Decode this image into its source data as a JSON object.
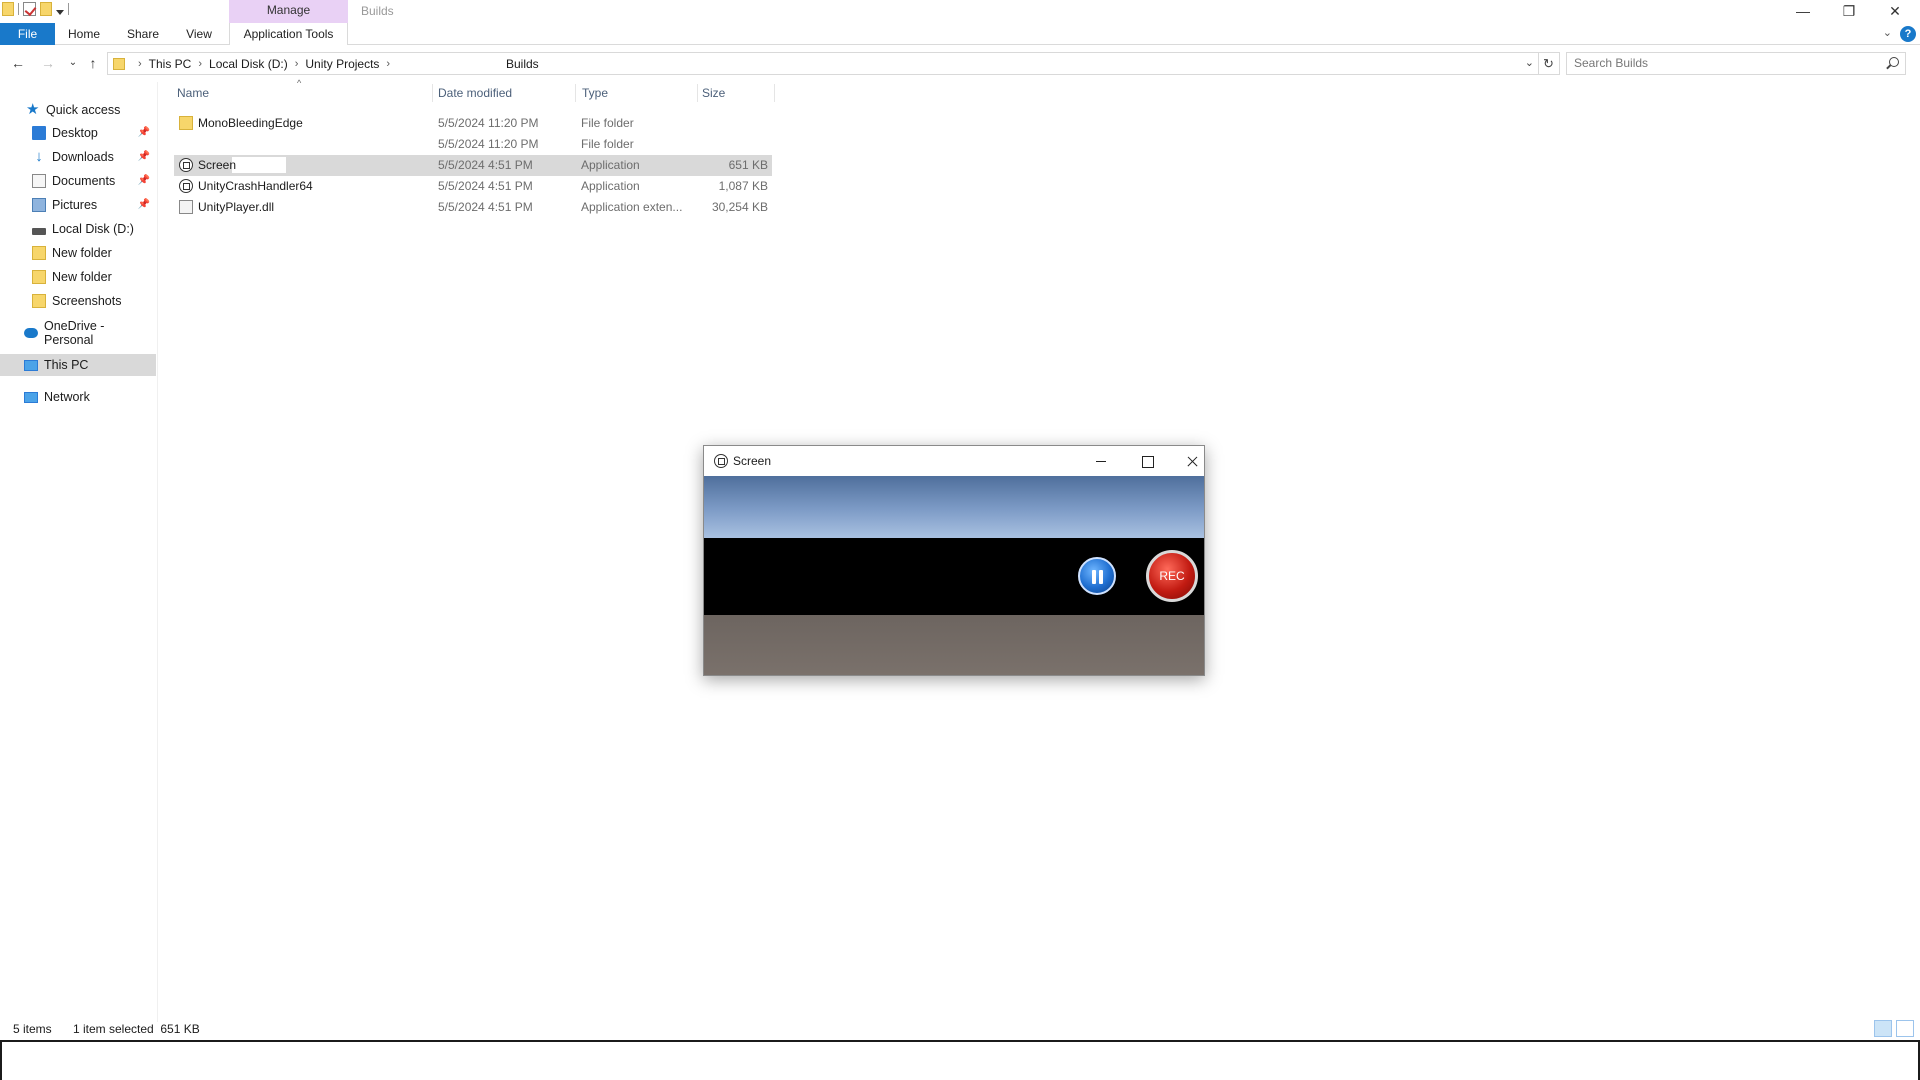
{
  "quick_access_toolbar": {
    "customize_arrow": "▾"
  },
  "ribbon": {
    "context_tab": "Manage",
    "window_title": "Builds",
    "tabs": {
      "file": "File",
      "home": "Home",
      "share": "Share",
      "view": "View",
      "app_tools": "Application Tools"
    },
    "help": "?"
  },
  "window_controls": {
    "minimize": "—",
    "restore": "❐",
    "close": "✕"
  },
  "address": {
    "crumbs": [
      "This PC",
      "Local Disk (D:)",
      "Unity Projects",
      "Builds"
    ],
    "search_placeholder": "Search Builds"
  },
  "sidebar": {
    "quick_access": "Quick access",
    "items": [
      "Desktop",
      "Downloads",
      "Documents",
      "Pictures",
      "Local Disk (D:)",
      "New folder",
      "New folder",
      "Screenshots"
    ],
    "onedrive": "OneDrive - Personal",
    "this_pc": "This PC",
    "network": "Network"
  },
  "columns": {
    "name": "Name",
    "date": "Date modified",
    "type": "Type",
    "size": "Size"
  },
  "files": [
    {
      "name": "MonoBleedingEdge",
      "date": "5/5/2024 11:20 PM",
      "type": "File folder",
      "size": "",
      "icon": "folder-icon"
    },
    {
      "name": "",
      "date": "5/5/2024 11:20 PM",
      "type": "File folder",
      "size": "",
      "icon": "none"
    },
    {
      "name": "Screen",
      "date": "5/5/2024 4:51 PM",
      "type": "Application",
      "size": "651 KB",
      "icon": "unity-app-icon"
    },
    {
      "name": "UnityCrashHandler64",
      "date": "5/5/2024 4:51 PM",
      "type": "Application",
      "size": "1,087 KB",
      "icon": "unity-app-icon"
    },
    {
      "name": "UnityPlayer.dll",
      "date": "5/5/2024 4:51 PM",
      "type": "Application exten...",
      "size": "30,254 KB",
      "icon": "dll-icon"
    }
  ],
  "status": {
    "items": "5 items",
    "selected": "1 item selected  651 KB"
  },
  "unity_window": {
    "title": "Screen",
    "rec_label": "REC"
  }
}
